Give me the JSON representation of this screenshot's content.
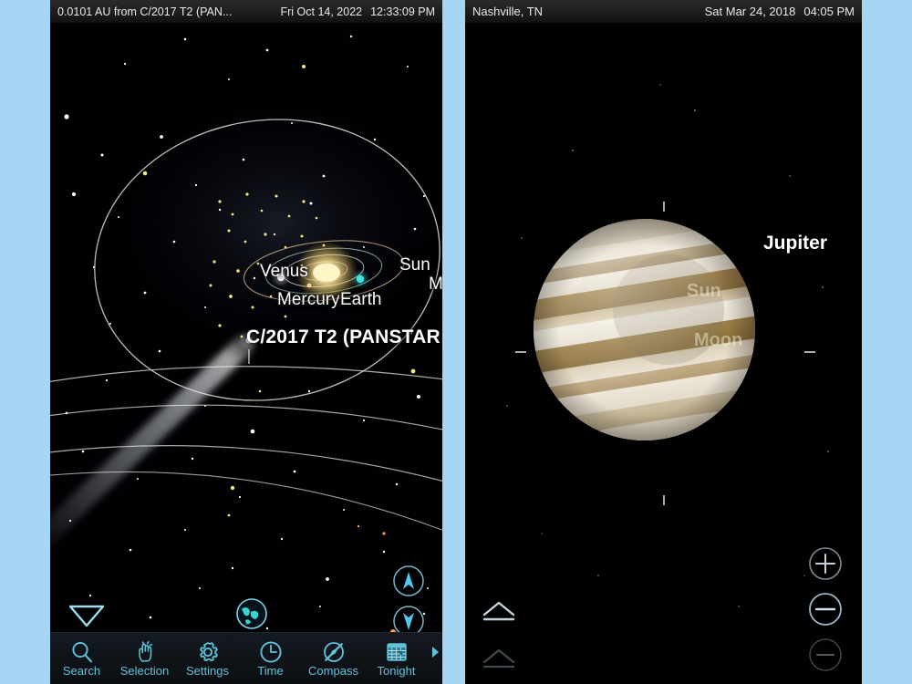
{
  "background_color": "#a7d6f5",
  "panels": {
    "left": {
      "name": "solar-system-view",
      "statusbar": {
        "info": "0.0101 AU from C/2017 T2 (PAN...",
        "date": "Fri Oct 14, 2022",
        "time": "12:33:09 PM"
      },
      "sky_labels": {
        "venus": "Venus",
        "sun": "Sun",
        "mars": "Mars",
        "mercury": "Mercury",
        "earth": "Earth",
        "comet": "C/2017 T2 (PANSTAR"
      },
      "controls": {
        "collapse": "collapse-triangle",
        "globe": "globe-icon",
        "up": "chevron-up-icon",
        "down": "chevron-down-icon"
      },
      "toolbar": {
        "accent_color": "#5fc4da",
        "items": [
          {
            "label": "Search",
            "icon": "search-icon"
          },
          {
            "label": "Selection",
            "icon": "hand-touch-icon"
          },
          {
            "label": "Settings",
            "icon": "gear-icon"
          },
          {
            "label": "Time",
            "icon": "clock-icon"
          },
          {
            "label": "Compass",
            "icon": "compass-icon"
          },
          {
            "label": "Tonight",
            "icon": "calendar-icon"
          }
        ],
        "more": "chevron-right-icon"
      }
    },
    "right": {
      "name": "jupiter-view",
      "statusbar": {
        "location": "Nashville, TN",
        "date": "Sat Mar 24, 2018",
        "time": "04:05 PM"
      },
      "sky_labels": {
        "jupiter": "Jupiter",
        "faint_sun": "Sun",
        "faint_moon": "Moon"
      },
      "controls": {
        "zoom_in": "plus-icon",
        "zoom_out": "minus-icon",
        "zoom_out_secondary": "minus-icon",
        "expand_primary": "chevron-up-icon",
        "expand_secondary": "chevron-up-icon"
      }
    }
  }
}
